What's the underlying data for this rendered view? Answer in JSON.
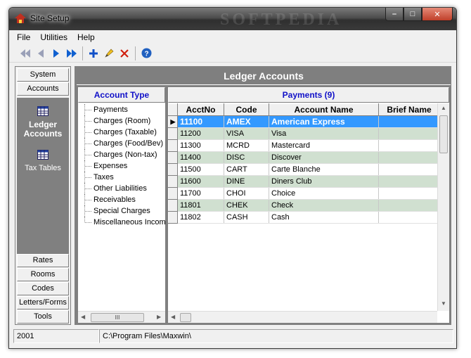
{
  "window": {
    "title": "Site Setup",
    "watermark": "SOFTPEDIA"
  },
  "menu": [
    "File",
    "Utilities",
    "Help"
  ],
  "toolbar": [
    {
      "icon": "first-record-icon"
    },
    {
      "icon": "previous-record-icon"
    },
    {
      "icon": "next-record-icon"
    },
    {
      "icon": "last-record-icon"
    },
    {
      "icon": "add-icon"
    },
    {
      "icon": "edit-icon"
    },
    {
      "icon": "delete-icon"
    },
    {
      "icon": "help-icon"
    }
  ],
  "sidebar": {
    "top_buttons": [
      "System",
      "Accounts"
    ],
    "panel_items": [
      {
        "label": "Ledger Accounts",
        "icon": "grid-icon",
        "active": true
      },
      {
        "label": "Tax Tables",
        "icon": "grid-icon",
        "active": false
      }
    ],
    "bottom_buttons": [
      "Rates",
      "Rooms",
      "Codes",
      "Letters/Forms",
      "Tools"
    ]
  },
  "main": {
    "header": "Ledger Accounts",
    "account_type": {
      "title": "Account Type",
      "items": [
        "Payments",
        "Charges (Room)",
        "Charges (Taxable)",
        "Charges (Food/Bev)",
        "Charges (Non-tax)",
        "Expenses",
        "Taxes",
        "Other Liabilities",
        "Receivables",
        "Special Charges",
        "Miscellaneous Income"
      ]
    },
    "payments": {
      "title": "Payments (9)",
      "columns": [
        "AcctNo",
        "Code",
        "Account Name",
        "Brief Name"
      ],
      "rows": [
        [
          "11100",
          "AMEX",
          "American Express",
          ""
        ],
        [
          "11200",
          "VISA",
          "Visa",
          ""
        ],
        [
          "11300",
          "MCRD",
          "Mastercard",
          ""
        ],
        [
          "11400",
          "DISC",
          "Discover",
          ""
        ],
        [
          "11500",
          "CART",
          "Carte Blanche",
          ""
        ],
        [
          "11600",
          "DINE",
          "Diners Club",
          ""
        ],
        [
          "11700",
          "CHOI",
          "Choice",
          ""
        ],
        [
          "11801",
          "CHEK",
          "Check",
          ""
        ],
        [
          "11802",
          "CASH",
          "Cash",
          ""
        ]
      ],
      "selected_row": 0
    }
  },
  "status": {
    "year": "2001",
    "path": "C:\\Program Files\\Maxwin\\"
  },
  "colors": {
    "selection": "#3399ff",
    "alt_row": "#d0e0d0",
    "title_blue": "#1010c8",
    "panel_gray": "#808080"
  }
}
